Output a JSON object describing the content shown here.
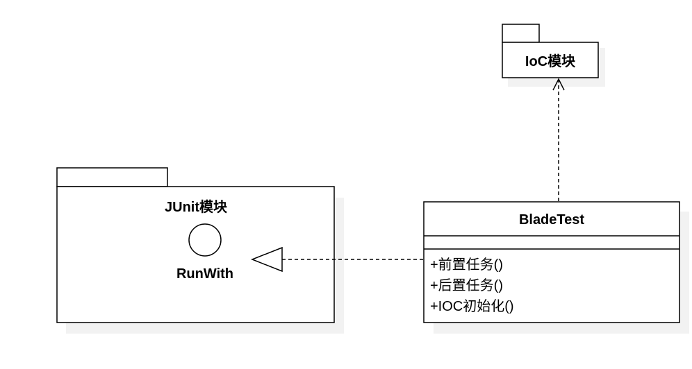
{
  "ioc_package": {
    "name": "IoC模块"
  },
  "junit_package": {
    "name": "JUnit模块",
    "interface": {
      "name": "RunWith"
    }
  },
  "blade_class": {
    "name": "BladeTest",
    "methods": [
      "+前置任务()",
      "+后置任务()",
      "+IOC初始化()"
    ]
  },
  "colors": {
    "stroke": "#000000",
    "shadow": "#f2f2f2",
    "background": "#ffffff"
  }
}
